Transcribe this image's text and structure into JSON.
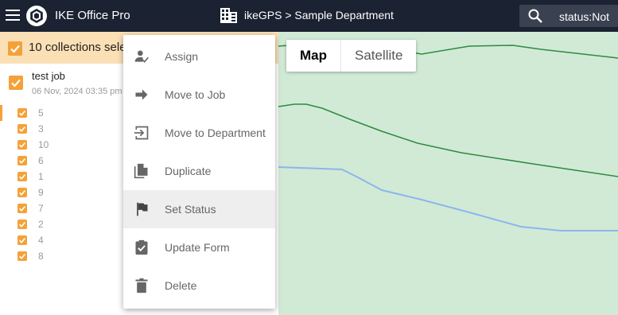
{
  "header": {
    "app_title": "IKE Office Pro",
    "breadcrumb": "ikeGPS > Sample Department",
    "search_value": "status:Not"
  },
  "selection": {
    "text": "10 collections sele"
  },
  "job": {
    "title": "test job",
    "date": "06 Nov, 2024 03:35 pm"
  },
  "items": [
    {
      "label": "5"
    },
    {
      "label": "3"
    },
    {
      "label": "10"
    },
    {
      "label": "6"
    },
    {
      "label": "1"
    },
    {
      "label": "9"
    },
    {
      "label": "7"
    },
    {
      "label": "2"
    },
    {
      "label": "4"
    },
    {
      "label": "8"
    }
  ],
  "map": {
    "map_label": "Map",
    "satellite_label": "Satellite",
    "selected": "Map"
  },
  "context_menu": {
    "items": [
      {
        "label": "Assign",
        "icon": "assign-user-icon"
      },
      {
        "label": "Move to Job",
        "icon": "arrow-right-icon"
      },
      {
        "label": "Move to Department",
        "icon": "move-to-icon"
      },
      {
        "label": "Duplicate",
        "icon": "duplicate-icon"
      },
      {
        "label": "Set Status",
        "icon": "flag-icon",
        "highlighted": true
      },
      {
        "label": "Update Form",
        "icon": "clipboard-check-icon"
      },
      {
        "label": "Delete",
        "icon": "trash-icon"
      }
    ]
  },
  "colors": {
    "topbar": "#1b2232",
    "accent": "#f5a13a",
    "selection_bg": "#fbe0b6",
    "map_bg": "#d1ead6",
    "road_green": "#2e8b3e",
    "road_blue": "#8cb6ec"
  }
}
